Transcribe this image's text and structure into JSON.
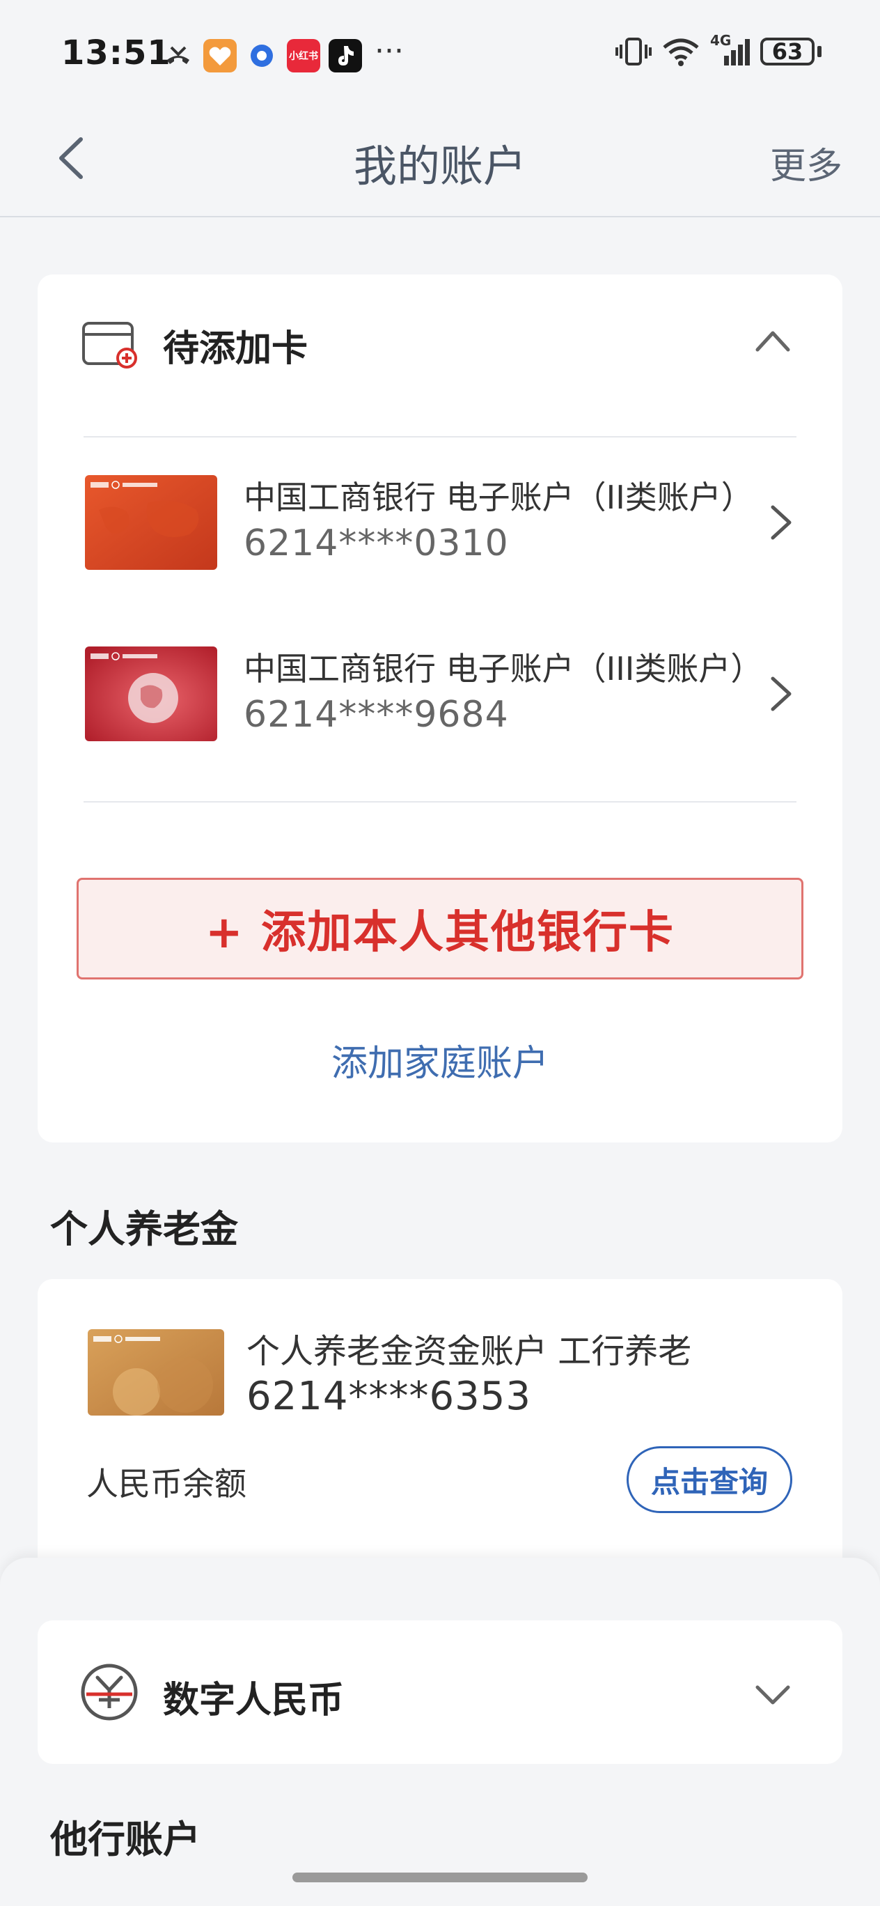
{
  "status_bar": {
    "time": "13:51",
    "app_icons": [
      "missed-call-icon",
      "health-app-icon",
      "browser-app-icon",
      "xiaohongshu-app-icon",
      "douyin-app-icon"
    ],
    "xiaohongshu_label": "小红书",
    "overflow": "···",
    "network": "4G",
    "battery": "63"
  },
  "nav": {
    "title": "我的账户",
    "more": "更多"
  },
  "pending_cards": {
    "title": "待添加卡",
    "accounts": [
      {
        "name": "中国工商银行  电子账户（II类账户）",
        "number": "6214****0310"
      },
      {
        "name": "中国工商银行  电子账户（III类账户）",
        "number": "6214****9684"
      }
    ],
    "add_button": "+ 添加本人其他银行卡",
    "family_link": "添加家庭账户"
  },
  "pension": {
    "section_title": "个人养老金",
    "account_name": "个人养老金资金账户  工行养老",
    "account_number": "6214****6353",
    "balance_label": "人民币余额",
    "query_button": "点击查询"
  },
  "ecny": {
    "title": "数字人民币"
  },
  "other_accounts": {
    "section_title": "他行账户"
  },
  "colors": {
    "accent_red": "#d8302c",
    "link_blue": "#3f6db0",
    "query_blue": "#2f64b8"
  }
}
